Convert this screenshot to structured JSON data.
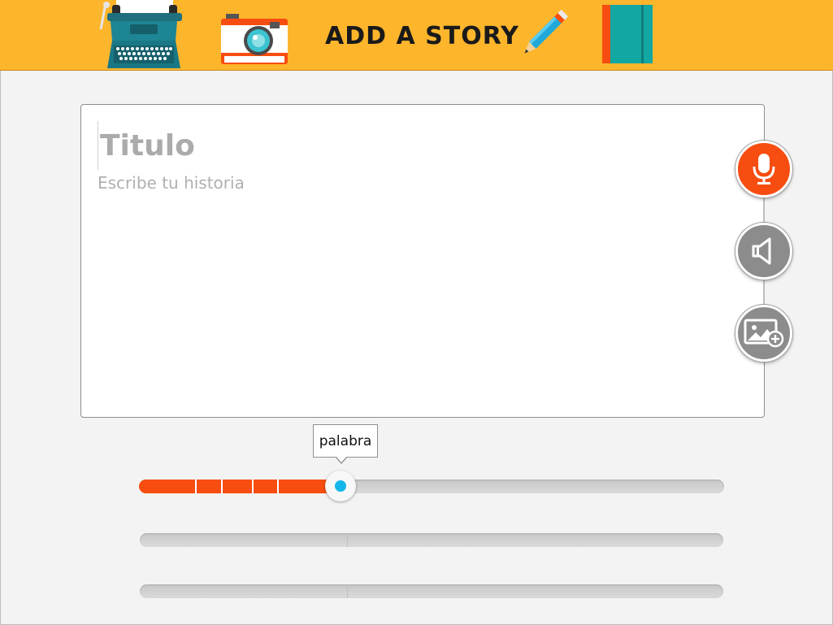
{
  "header": {
    "title": "ADD A STORY",
    "background": "#fdb52b",
    "decorations": [
      "typewriter-icon",
      "camera-icon",
      "pencil-icon",
      "notebook-icon"
    ]
  },
  "editor": {
    "title_placeholder": "Titulo",
    "story_placeholder": "Escribe tu historia"
  },
  "side_buttons": [
    {
      "name": "microphone-button",
      "icon": "microphone-icon",
      "color": "#f74d10"
    },
    {
      "name": "speaker-button",
      "icon": "speaker-icon",
      "color": "#8c8c8c"
    },
    {
      "name": "add-image-button",
      "icon": "add-image-icon",
      "color": "#8c8c8c"
    }
  ],
  "timeline": {
    "tooltip": "palabra",
    "accent": "#f74d10",
    "thumb_color": "#14b7ea",
    "track_1_progress": 0.345
  }
}
